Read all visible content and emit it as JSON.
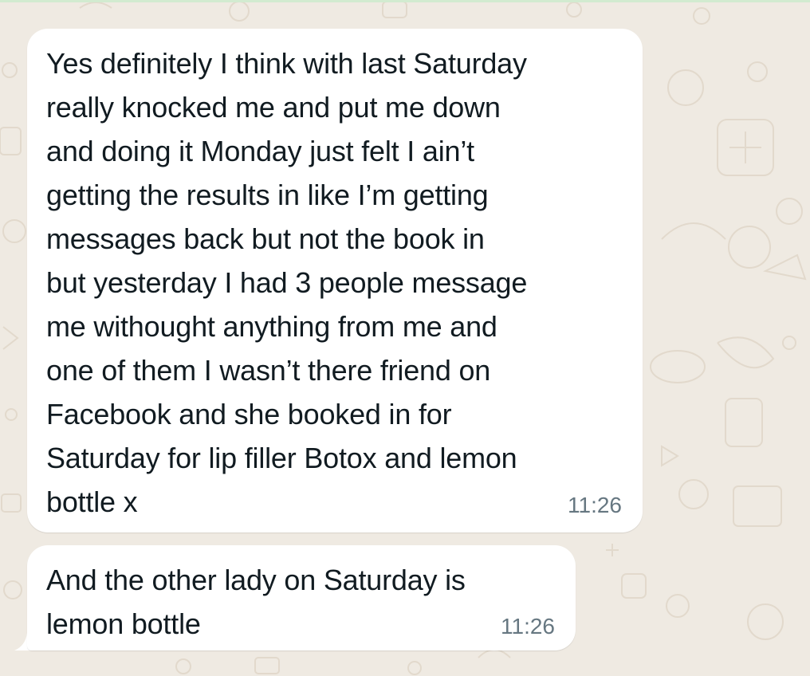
{
  "chat": {
    "background_color": "#efeae2",
    "bubble_color": "#ffffff",
    "messages": [
      {
        "text": "Yes definitely I think with last Saturday\nreally knocked me and put me down\nand doing it Monday just felt I ain’t\ngetting the results in like I’m getting\nmessages back but not the book in\nbut yesterday I had 3 people message\nme withought anything from me and\none of them I wasn’t there friend on\nFacebook and she booked in for\nSaturday for lip filler Botox and lemon\nbottle x",
        "time": "11:26"
      },
      {
        "text": "And the other lady on Saturday is\nlemon bottle",
        "time": "11:26"
      }
    ]
  }
}
